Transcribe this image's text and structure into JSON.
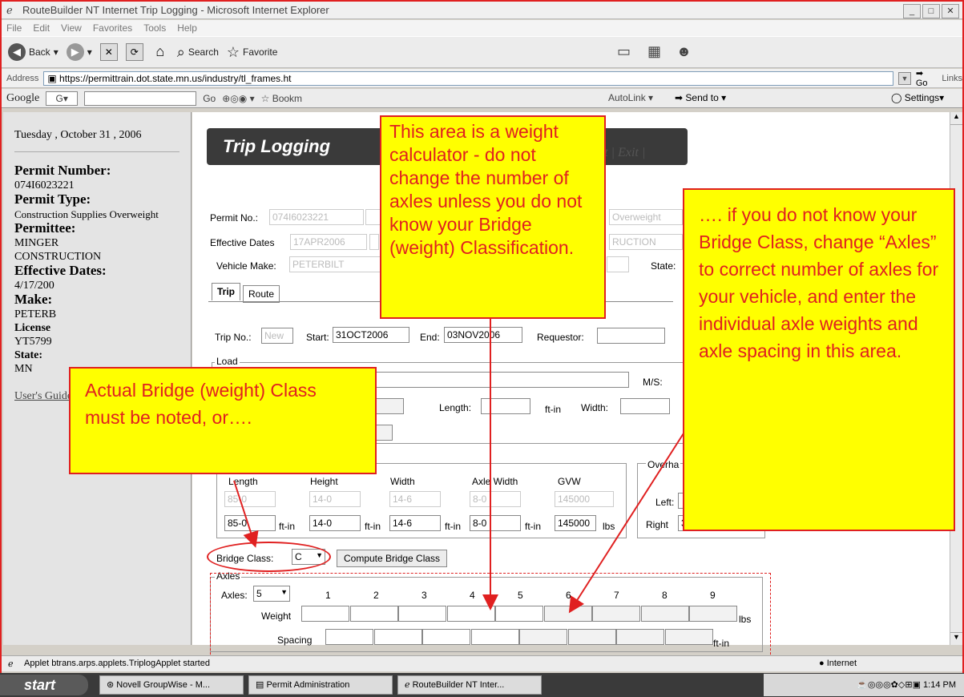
{
  "window": {
    "title": "RouteBuilder NT Internet Trip Logging - Microsoft Internet Explorer"
  },
  "menu": [
    "File",
    "Edit",
    "View",
    "Favorites",
    "Tools",
    "Help"
  ],
  "toolbar": {
    "back": "Back",
    "search": "Search",
    "favorites": "Favorite"
  },
  "address": {
    "label": "Address",
    "url": "https://permittrain.dot.state.mn.us/industry/tl_frames.ht",
    "go": "Go",
    "links": "Links"
  },
  "google": {
    "logo": "Google",
    "go": "Go",
    "bookmarks": "Bookm",
    "autolink": "AutoLink",
    "sendto": "Send to",
    "settings": "Settings"
  },
  "sidebar": {
    "date": "Tuesday , October 31 , 2006",
    "permit_number_label": "Permit Number:",
    "permit_number": "074I6023221",
    "permit_type_label": "Permit Type:",
    "permit_type": "Construction Supplies Overweight",
    "permittee_label": "Permittee:",
    "permittee": "MINGER CONSTRUCTION",
    "effective_label": "Effective Dates:",
    "effective": "4/17/200",
    "make_label": "Make:",
    "make": "PETERB",
    "license_label": "License",
    "license": "YT5799",
    "state_label": "State:",
    "state": "MN",
    "guide": "User's Guide"
  },
  "banner": {
    "title": "Trip Logging",
    "links": "ust | Exit |"
  },
  "form": {
    "permit_no_label": "Permit No.:",
    "permit_no": "074I6023221",
    "permit_type_val": "Overweight",
    "effective_label": "Effective Dates",
    "effective_val": "17APR2006",
    "effective_val2": "RUCTION",
    "make_label": "Vehicle Make:",
    "make_val": "PETERBILT",
    "state_label": "State:",
    "tab_trip": "Trip",
    "tab_route": "Route",
    "trip_no_label": "Trip No.:",
    "trip_no_ph": "New",
    "start_label": "Start:",
    "start_val": "31OCT2006",
    "end_label": "End:",
    "end_val": "03NOV2006",
    "requestor_label": "Requestor:",
    "load_label": "Load",
    "ms_label": "M/S:",
    "length_label": "Length:",
    "ftin": "ft-in",
    "width_label": "Width:",
    "ft_short": "ft-",
    "overhang_label": "Overha",
    "dims_headers": [
      "Length",
      "Height",
      "Width",
      "Axle Width",
      "GVW"
    ],
    "dims_gray": [
      "85-0",
      "14-0",
      "14-6",
      "8-0",
      "145000"
    ],
    "dims_vals": [
      "85-0",
      "14-0",
      "14-6",
      "8-0",
      "145000"
    ],
    "lbs": "lbs",
    "left_label": "Left:",
    "right_label": "Right",
    "right_val": "3-3",
    "bridge_label": "Bridge Class:",
    "bridge_val": "C",
    "compute_btn": "Compute Bridge Class",
    "axles_group": "Axles",
    "axles_label": "Axles:",
    "axles_val": "5",
    "axle_nums": [
      "1",
      "2",
      "3",
      "4",
      "5",
      "6",
      "7",
      "8",
      "9"
    ],
    "weight_label": "Weight",
    "spacing_label": "Spacing"
  },
  "status": {
    "text": "Applet btrans.arps.applets.TriplogApplet started",
    "zone": "Internet"
  },
  "taskbar": {
    "start": "start",
    "tasks": [
      "Novell GroupWise - M...",
      "Permit Administration",
      "RouteBuilder NT Inter..."
    ],
    "time": "1:14 PM"
  },
  "callouts": {
    "top": "This area is a weight calculator - do not change the number of axles unless you do not know your Bridge (weight) Classification.",
    "right": "…. if you do not know your Bridge Class, change “Axles” to correct number of axles for your vehicle, and enter the individual axle weights and axle spacing in this area.",
    "left": "Actual Bridge (weight) Class must be noted, or…."
  },
  "colors": {
    "callout_bg": "#ffff00",
    "callout_text": "#e02020"
  }
}
